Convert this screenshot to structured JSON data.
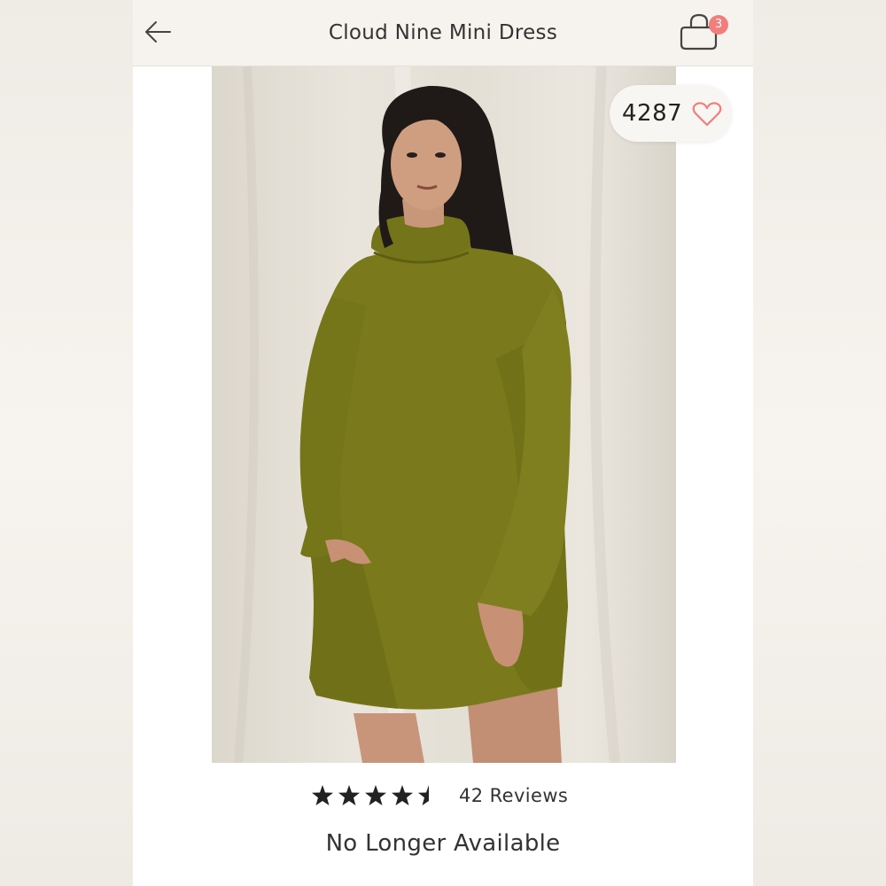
{
  "header": {
    "title": "Cloud Nine Mini Dress",
    "back_icon": "arrow-left-icon",
    "bag_icon": "shopping-bag-icon",
    "bag_count": "3"
  },
  "product": {
    "image_alt": "Model wearing olive green turtleneck sweater mini dress",
    "likes": "4287",
    "like_icon": "heart-outline-icon",
    "rating": 4.5,
    "rating_max": 5,
    "reviews_label": "42 Reviews",
    "status": "No Longer Available"
  },
  "colors": {
    "badge": "#f27d7a",
    "heart": "#f27d7a",
    "dress": "#7a7a1c",
    "text": "#333333"
  }
}
